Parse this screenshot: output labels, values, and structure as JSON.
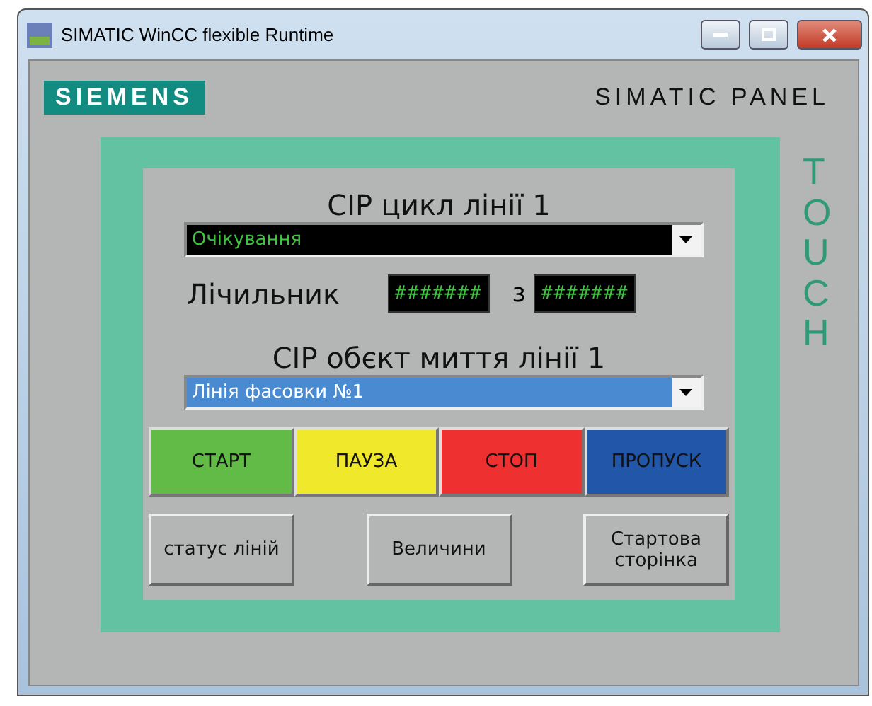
{
  "window": {
    "title": "SIMATIC WinCC flexible Runtime"
  },
  "header": {
    "logo": "SIEMENS",
    "product": "SIMATIC PANEL"
  },
  "side_label": "TOUCH",
  "cycle": {
    "title": "CIP цикл лінії 1",
    "value": "Очікування",
    "highlighted": false
  },
  "counter": {
    "label": "Лічильник",
    "value": "#######",
    "separator": "з",
    "total": "#######"
  },
  "object": {
    "title": "CIP обєкт миття лінії 1",
    "value": "Лінія фасовки №1",
    "highlighted": true
  },
  "actions": [
    {
      "label": "СТАРТ",
      "color": "#62bb46"
    },
    {
      "label": "ПАУЗА",
      "color": "#f0e82a"
    },
    {
      "label": "СТОП",
      "color": "#ee3030"
    },
    {
      "label": "ПРОПУСК",
      "color": "#2256a8"
    }
  ],
  "nav": [
    {
      "label": "статус ліній"
    },
    {
      "label": "Величини"
    },
    {
      "label": "Стартова сторінка"
    }
  ]
}
